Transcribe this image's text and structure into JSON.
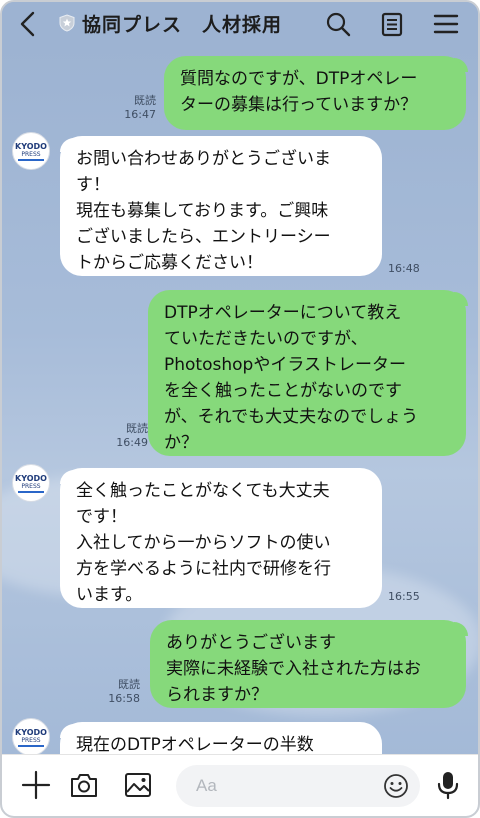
{
  "header": {
    "title": "協同プレス　人材採用"
  },
  "avatar": {
    "line1": "KYODO",
    "line2": "PRESS"
  },
  "messages": [
    {
      "side": "out",
      "text": "質問なのですが、DTPオペレー\nターの募集は行っていますか？",
      "read": "既読",
      "time": "16:47"
    },
    {
      "side": "in",
      "text": "お問い合わせありがとうございま\nす！\n現在も募集しております。ご興味\nございましたら、エントリーシー\nトからご応募ください！",
      "time": "16:48"
    },
    {
      "side": "out",
      "text": "DTPオペレーターについて教え\nていただきたいのですが、\nPhotoshopやイラストレーター\nを全く触ったことがないのです\nが、それでも大丈夫なのでしょう\nか？",
      "read": "既読",
      "time": "16:49"
    },
    {
      "side": "in",
      "text": "全く触ったことがなくても大丈夫\nです！\n入社してから一からソフトの使い\n方を学べるように社内で研修を行\nいます。",
      "time": "16:55"
    },
    {
      "side": "out",
      "text": "ありがとうございます\n実際に未経験で入社された方はお\nられますか？",
      "read": "既読",
      "time": "16:58"
    },
    {
      "side": "in",
      "text": "現在のDTPオペレーターの半数",
      "time": ""
    }
  ],
  "composer": {
    "placeholder": "Aa"
  },
  "colors": {
    "background": "#9db3d2",
    "outgoing": "#86d97b",
    "incoming": "#ffffff"
  },
  "icons": [
    "back-arrow-icon",
    "official-badge-icon",
    "search-icon",
    "notes-icon",
    "menu-icon",
    "plus-icon",
    "camera-icon",
    "image-icon",
    "smile-icon",
    "microphone-icon"
  ]
}
